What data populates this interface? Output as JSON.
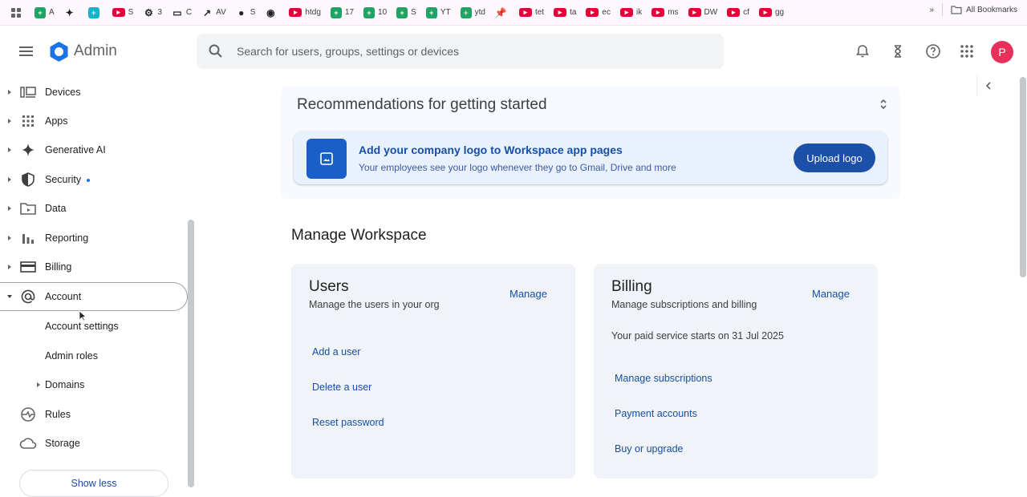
{
  "bookmarks": {
    "items": [
      {
        "label": "",
        "icon": "apps-grid-icon"
      },
      {
        "label": "A",
        "icon": "sheets-icon"
      },
      {
        "label": "",
        "icon": "puzzle-icon"
      },
      {
        "label": "",
        "icon": "sheets-icon"
      },
      {
        "label": "S",
        "icon": "youtube-icon"
      },
      {
        "label": "3",
        "icon": "gear-icon"
      },
      {
        "label": "C",
        "icon": "folder-icon"
      },
      {
        "label": "AV",
        "icon": "trend-icon"
      },
      {
        "label": "S",
        "icon": "globe-icon"
      },
      {
        "label": "",
        "icon": "github-icon"
      },
      {
        "label": "htdg",
        "icon": "youtube-icon"
      },
      {
        "label": "17",
        "icon": "sheets-icon"
      },
      {
        "label": "10",
        "icon": "sheets-icon"
      },
      {
        "label": "S",
        "icon": "sheets-icon"
      },
      {
        "label": "YT",
        "icon": "sheets-icon"
      },
      {
        "label": "ytd",
        "icon": "sheets-icon"
      },
      {
        "label": "",
        "icon": "pin-icon"
      },
      {
        "label": "tet",
        "icon": "youtube-icon"
      },
      {
        "label": "ta",
        "icon": "youtube-icon"
      },
      {
        "label": "ec",
        "icon": "youtube-icon"
      },
      {
        "label": "ik",
        "icon": "youtube-icon"
      },
      {
        "label": "ms",
        "icon": "youtube-icon"
      },
      {
        "label": "DW",
        "icon": "youtube-icon"
      },
      {
        "label": "cf",
        "icon": "youtube-icon"
      },
      {
        "label": "gg",
        "icon": "youtube-icon"
      }
    ],
    "overflow": "»",
    "all_bookmarks": "All Bookmarks"
  },
  "header": {
    "brand": "Admin",
    "search_placeholder": "Search for users, groups, settings or devices",
    "avatar_initial": "P"
  },
  "sidebar": {
    "items": [
      {
        "label": "Devices",
        "icon": "devices-icon"
      },
      {
        "label": "Apps",
        "icon": "apps-grid-icon"
      },
      {
        "label": "Generative AI",
        "icon": "sparkle-icon"
      },
      {
        "label": "Security",
        "icon": "shield-icon"
      },
      {
        "label": "Data",
        "icon": "folder-data-icon"
      },
      {
        "label": "Reporting",
        "icon": "bar-chart-icon"
      },
      {
        "label": "Billing",
        "icon": "credit-card-icon"
      },
      {
        "label": "Account",
        "icon": "at-sign-icon"
      }
    ],
    "account_sub": [
      "Account settings",
      "Admin roles",
      "Domains"
    ],
    "tail_items": [
      {
        "label": "Rules",
        "icon": "rules-icon"
      },
      {
        "label": "Storage",
        "icon": "cloud-icon"
      }
    ],
    "show_less": "Show less"
  },
  "recommendations": {
    "title": "Recommendations for getting started",
    "card_heading": "Add your company logo to Workspace app pages",
    "card_sub": "Your employees see your logo whenever they go to Gmail, Drive and more",
    "button": "Upload logo"
  },
  "manage": {
    "title": "Manage Workspace",
    "users": {
      "title": "Users",
      "desc": "Manage the users in your org",
      "manage": "Manage",
      "links": [
        "Add a user",
        "Delete a user",
        "Reset password"
      ]
    },
    "billing": {
      "title": "Billing",
      "desc": "Manage subscriptions and billing",
      "manage": "Manage",
      "note": "Your paid service starts on 31 Jul 2025",
      "links": [
        "Manage subscriptions",
        "Payment accounts",
        "Buy or upgrade"
      ]
    }
  },
  "colors": {
    "accent": "#1a73e8",
    "link": "#174ea6",
    "upload_button": "#1c4fa8",
    "avatar": "#e8305a"
  }
}
